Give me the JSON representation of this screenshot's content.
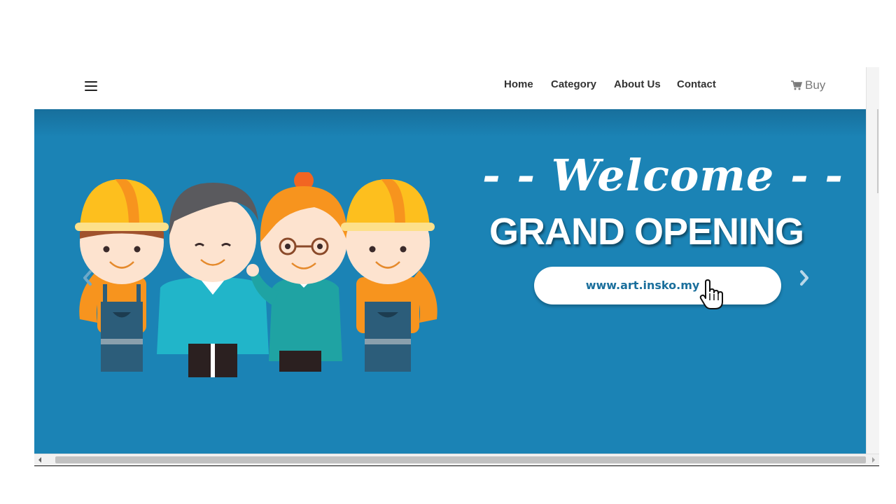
{
  "nav": {
    "items": [
      {
        "label": "Home"
      },
      {
        "label": "Category"
      },
      {
        "label": "About Us"
      },
      {
        "label": "Contact"
      }
    ],
    "buy_label": "Buy"
  },
  "banner": {
    "welcome": "- - Welcome - -",
    "headline": "GRAND OPENING",
    "url": "www.art.insko.my"
  },
  "colors": {
    "banner_bg": "#1b83b5",
    "helmet": "#fdbf1e",
    "helmet_orange": "#f7941e",
    "skin": "#fde3cf",
    "teal": "#21b5c9",
    "overall": "#2c5d7a"
  },
  "icons": {
    "menu": "hamburger-icon",
    "cart": "shopping-cart-icon",
    "prev": "chevron-left-icon",
    "next": "chevron-right-icon",
    "pointer": "hand-pointer-icon"
  }
}
